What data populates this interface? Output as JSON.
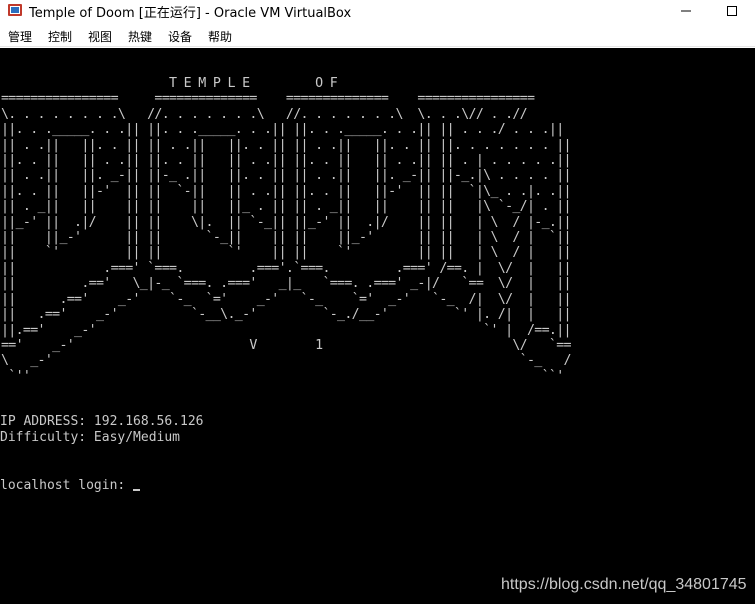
{
  "window": {
    "title": "Temple of Doom [正在运行] - Oracle VM VirtualBox",
    "icon": "virtualbox-icon",
    "controls": [
      "minimize-icon",
      "maximize-icon"
    ]
  },
  "menu": {
    "items": [
      "管理",
      "控制",
      "视图",
      "热键",
      "设备",
      "帮助"
    ]
  },
  "console": {
    "banner_title": "T E M P L E         O F",
    "ascii_art": "                       T E M P L E         O F\n================     ==============    ==============    ================\n\\. . . . . . . .\\   //. . . . . . .\\   //. . . . . . .\\  \\. . .\\// . .//\n||. . ._____. . .|| ||. . ._____. . .|| ||. . ._____. . .|| || . . ./ . . .||\n|| . .||   ||. . || || . .||   ||. . || || . .||   ||. . || ||. . . . . . . ||\n||. . ||   || . .|| ||. . ||   || . .|| ||. . ||   || . .|| || . | . . . . .||\n|| . .||   ||. _-|| ||-_ .||   ||. . || || . .||   ||. _-|| ||-_.|\\ . . . . ||\n||. . ||   ||-'  || ||  `-||   || . .|| ||. . ||   ||-'  || ||  `|\\_ . .|. .||\n|| . _||   ||    || ||    ||   ||_ . || || . _||   ||    || ||   |\\ `-_/| . ||\n||_-' ||  .|/    || ||    \\|.  || `-_|| ||_-' ||  .|/    || ||   | \\  / |-_.||\n||    ||_-'      || ||      `-_||    || ||    ||_-'      || ||   | \\  / |  `||\n||    `'         || ||         `'    || ||    `'         || ||   | \\  / |   ||\n||            .===' `===.         .==='.`===.         .===' /==. |  \\/  |   ||\n||         .=='   \\_|-_ `===. .==='   _|_   `===. .===' _-|/   `==  \\/  |   ||\n||      .=='    _-'    `-_  `='    _-'   `-_    `='  _-'   `-_  /|  \\/  |   ||\n||   .=='    _-'          `-__\\._-'         `-_./__-'         `' |. /|  |   ||\n||.=='    _-'                                                     `' |  /==.||\n=='    _-'                        V        1                          \\/   `==\n\\   _-'                                                                `-_   /\n `''                                                                      ``'",
    "version_text": "V        1",
    "ip_address_line": "IP ADDRESS: 192.168.56.126",
    "difficulty_line": "Difficulty: Easy/Medium",
    "login_prompt": "localhost login: "
  },
  "watermark": {
    "text": "https://blog.csdn.net/qq_34801745"
  },
  "colors": {
    "console_bg": "#000000",
    "console_text": "#c9c9c9",
    "icon_red": "#c0392b"
  }
}
